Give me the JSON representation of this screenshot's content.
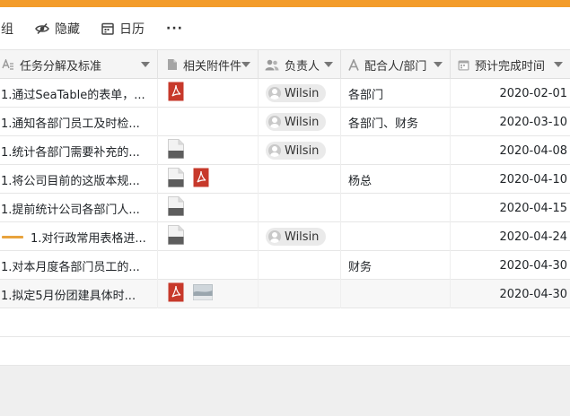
{
  "colors": {
    "accent": "#f39c2b",
    "pdf": "#c7392b"
  },
  "toolbar": {
    "group_label": "组",
    "hide_label": "隐藏",
    "calendar_label": "日历",
    "more_label": "···"
  },
  "columns": [
    {
      "label": "任务分解及标准",
      "icon": "text-icon"
    },
    {
      "label": "相关附件件",
      "icon": "file-icon"
    },
    {
      "label": "负责人",
      "icon": "people-icon"
    },
    {
      "label": "配合人/部门",
      "icon": "letter-a-icon"
    },
    {
      "label": "预计完成时间",
      "icon": "calendar-icon"
    }
  ],
  "rows": [
    {
      "task": "1.通过SeaTable的表单，...",
      "attachments": [
        "pdf"
      ],
      "owner": "Wilsin",
      "co": "各部门",
      "date": "2020-02-01"
    },
    {
      "task": "1.通知各部门员工及时检...",
      "attachments": [],
      "owner": "Wilsin",
      "co": "各部门、财务",
      "date": "2020-03-10"
    },
    {
      "task": "1.统计各部门需要补充的...",
      "attachments": [
        "doc"
      ],
      "owner": "Wilsin",
      "co": "",
      "date": "2020-04-08"
    },
    {
      "task": "1.将公司目前的这版本规...",
      "attachments": [
        "doc",
        "pdf"
      ],
      "owner": "",
      "co": "杨总",
      "date": "2020-04-10"
    },
    {
      "task": "1.提前统计公司各部门人...",
      "attachments": [
        "doc"
      ],
      "owner": "",
      "co": "",
      "date": "2020-04-15"
    },
    {
      "task": "1.对行政常用表格进...",
      "attachments": [
        "doc"
      ],
      "owner": "Wilsin",
      "co": "",
      "date": "2020-04-24"
    },
    {
      "task": "1.对本月度各部门员工的...",
      "attachments": [],
      "owner": "",
      "co": "财务",
      "date": "2020-04-30"
    },
    {
      "task": "1.拟定5月份团建具体时...",
      "attachments": [
        "pdf",
        "image"
      ],
      "owner": "",
      "co": "",
      "date": "2020-04-30"
    }
  ]
}
